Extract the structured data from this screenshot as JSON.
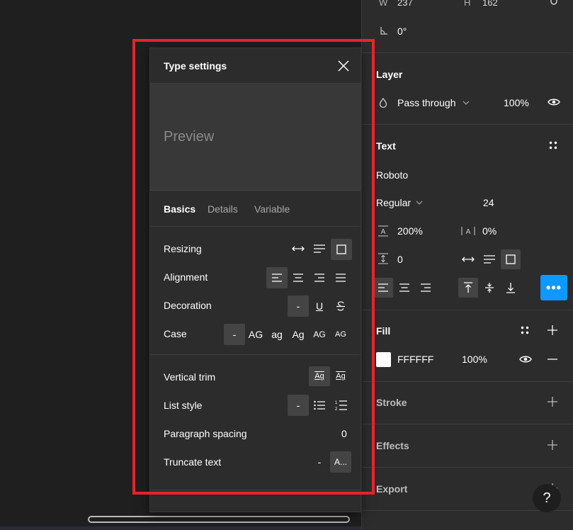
{
  "canvas": {},
  "right_panel": {
    "dims": {
      "w_label": "W",
      "w_value": "237",
      "h_label": "H",
      "h_value": "162",
      "rotation_value": "0°"
    },
    "layer": {
      "title": "Layer",
      "blend_mode": "Pass through",
      "opacity": "100%"
    },
    "text": {
      "title": "Text",
      "font_family": "Roboto",
      "font_weight": "Regular",
      "font_size": "24",
      "line_height": "200%",
      "letter_spacing": "0%",
      "paragraph_spacing": "0"
    },
    "fill": {
      "title": "Fill",
      "hex": "FFFFFF",
      "opacity": "100%"
    },
    "stroke": {
      "title": "Stroke"
    },
    "effects": {
      "title": "Effects"
    },
    "export": {
      "title": "Export"
    },
    "help": {
      "label": "?"
    }
  },
  "type_settings": {
    "title": "Type settings",
    "preview": "Preview",
    "tabs": [
      {
        "label": "Basics",
        "active": true
      },
      {
        "label": "Details",
        "active": false
      },
      {
        "label": "Variable",
        "active": false
      }
    ],
    "rows": {
      "resizing": "Resizing",
      "alignment": "Alignment",
      "decoration": "Decoration",
      "case": "Case",
      "vertical_trim": "Vertical trim",
      "list_style": "List style",
      "paragraph_spacing": "Paragraph spacing",
      "truncate_text": "Truncate text"
    },
    "decoration_none": "-",
    "decoration_underline": "U",
    "case_options": [
      "-",
      "AG",
      "ag",
      "Ag",
      "AG",
      "AG"
    ],
    "vertical_trim_options": [
      "Ag",
      "Ag"
    ],
    "list_none": "-",
    "paragraph_spacing_value": "0",
    "truncate_none": "-",
    "truncate_on": "A..."
  },
  "colors": {
    "accent": "#0d99ff",
    "highlight_frame": "#e8232a",
    "panel_bg": "#2c2c2c",
    "canvas_bg": "#1f1f1f"
  }
}
